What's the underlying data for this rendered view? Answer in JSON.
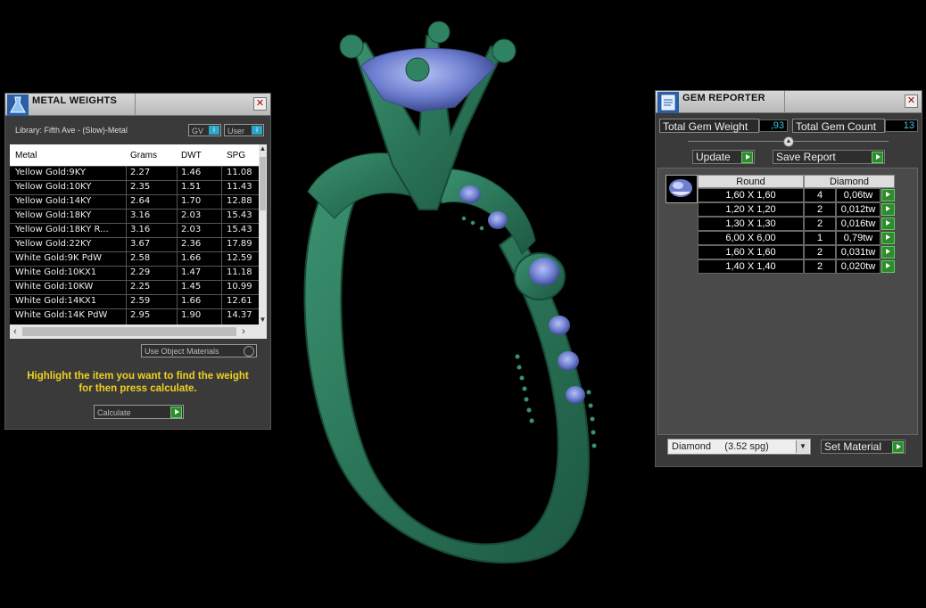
{
  "metal_weights": {
    "title": "METAL WEIGHTS",
    "library": "Library: Fifth Ave - (Slow)-Metal",
    "gv_label": "GV",
    "user_label": "User",
    "columns": [
      "Metal",
      "Grams",
      "DWT",
      "SPG"
    ],
    "rows": [
      [
        "Yellow Gold:9KY",
        "2.27",
        "1.46",
        "11.08"
      ],
      [
        "Yellow Gold:10KY",
        "2.35",
        "1.51",
        "11.43"
      ],
      [
        "Yellow Gold:14KY",
        "2.64",
        "1.70",
        "12.88"
      ],
      [
        "Yellow Gold:18KY",
        "3.16",
        "2.03",
        "15.43"
      ],
      [
        "Yellow Gold:18KY R...",
        "3.16",
        "2.03",
        "15.43"
      ],
      [
        "Yellow Gold:22KY",
        "3.67",
        "2.36",
        "17.89"
      ],
      [
        "White Gold:9K PdW",
        "2.58",
        "1.66",
        "12.59"
      ],
      [
        "White Gold:10KX1",
        "2.29",
        "1.47",
        "11.18"
      ],
      [
        "White Gold:10KW",
        "2.25",
        "1.45",
        "10.99"
      ],
      [
        "White Gold:14KX1",
        "2.59",
        "1.66",
        "12.61"
      ],
      [
        "White Gold:14K PdW",
        "2.95",
        "1.90",
        "14.37"
      ]
    ],
    "use_object_materials": "Use Object Materials",
    "hint_line1": "Highlight the item you want to find the weight",
    "hint_line2": "for then press calculate.",
    "calculate_label": "Calculate"
  },
  "gem_reporter": {
    "title": "GEM REPORTER",
    "total_weight_label": "Total Gem Weight",
    "total_weight_value": ",93",
    "total_count_label": "Total Gem Count",
    "total_count_value": "13",
    "update_label": "Update",
    "save_report_label": "Save Report",
    "col_shape": "Round",
    "col_material": "Diamond",
    "gems": [
      {
        "size": "1,60 X 1,60",
        "count": "4",
        "weight": "0,06tw"
      },
      {
        "size": "1,20 X 1,20",
        "count": "2",
        "weight": "0,012tw"
      },
      {
        "size": "1,30 X 1,30",
        "count": "2",
        "weight": "0,016tw"
      },
      {
        "size": "6,00 X 6,00",
        "count": "1",
        "weight": "0,79tw"
      },
      {
        "size": "1,60 X 1,60",
        "count": "2",
        "weight": "0,031tw"
      },
      {
        "size": "1,40 X 1,40",
        "count": "2",
        "weight": "0,020tw"
      }
    ],
    "material_select": "Diamond     (3.52 spg)",
    "set_material_label": "Set Material"
  },
  "colors": {
    "ring_metal": "#2e7a5a",
    "gem_blue": "#6f7fd0",
    "hint_yellow": "#f0d020",
    "value_cyan": "#3cc3e0",
    "button_green": "#2e8b2e"
  }
}
